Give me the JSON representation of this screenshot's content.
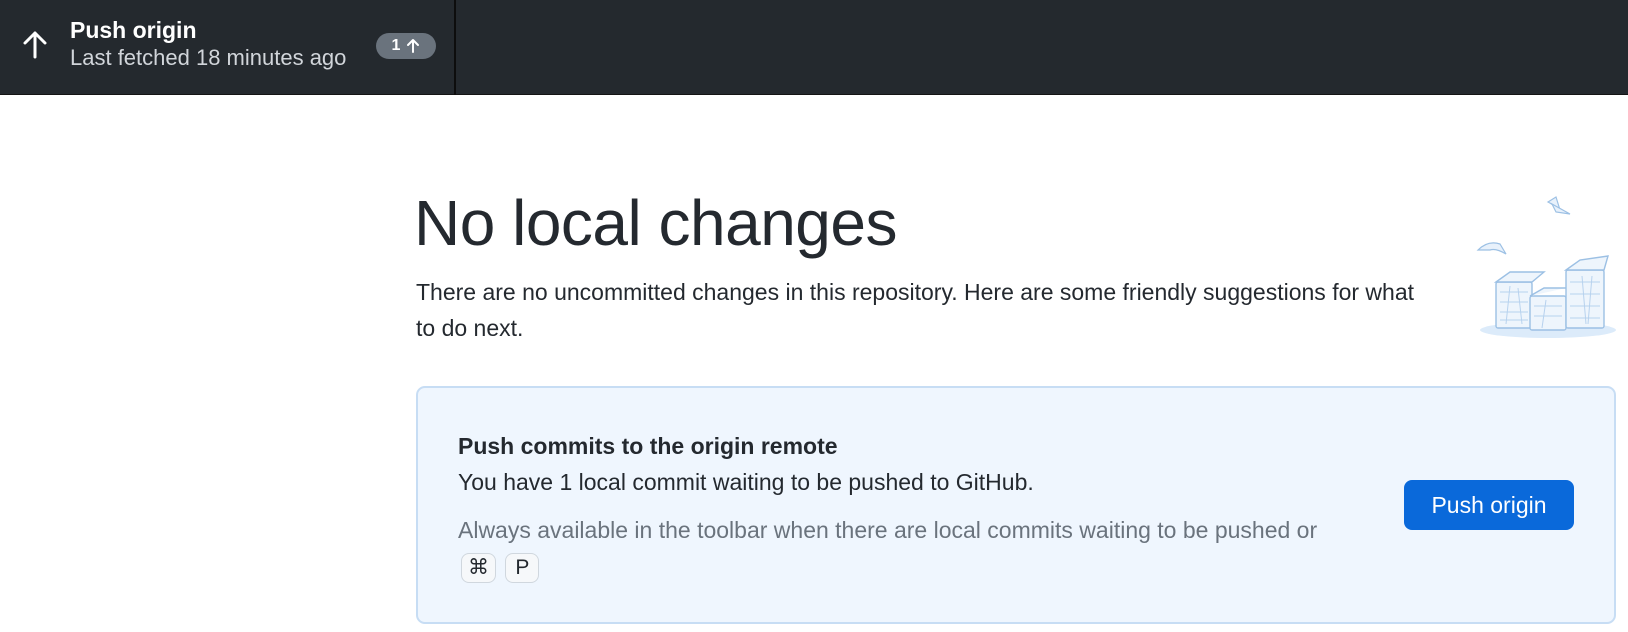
{
  "toolbar": {
    "push": {
      "title": "Push origin",
      "subtitle": "Last fetched 18 minutes ago",
      "ahead_count": "1",
      "icon": "arrow-up-icon"
    }
  },
  "main": {
    "heading": "No local changes",
    "description": "There are no uncommitted changes in this repository. Here are some friendly suggestions for what to do next.",
    "illustration": "no-changes-illustration"
  },
  "suggestion": {
    "title": "Push commits to the origin remote",
    "text": "You have 1 local commit waiting to be pushed to GitHub.",
    "hint_prefix": "Always available in the toolbar when there are local commits waiting to be pushed or",
    "shortcut_keys": [
      "⌘",
      "P"
    ],
    "button_label": "Push origin"
  },
  "colors": {
    "toolbar_bg": "#24292e",
    "accent": "#0a69da",
    "card_bg": "#eff6fe"
  }
}
